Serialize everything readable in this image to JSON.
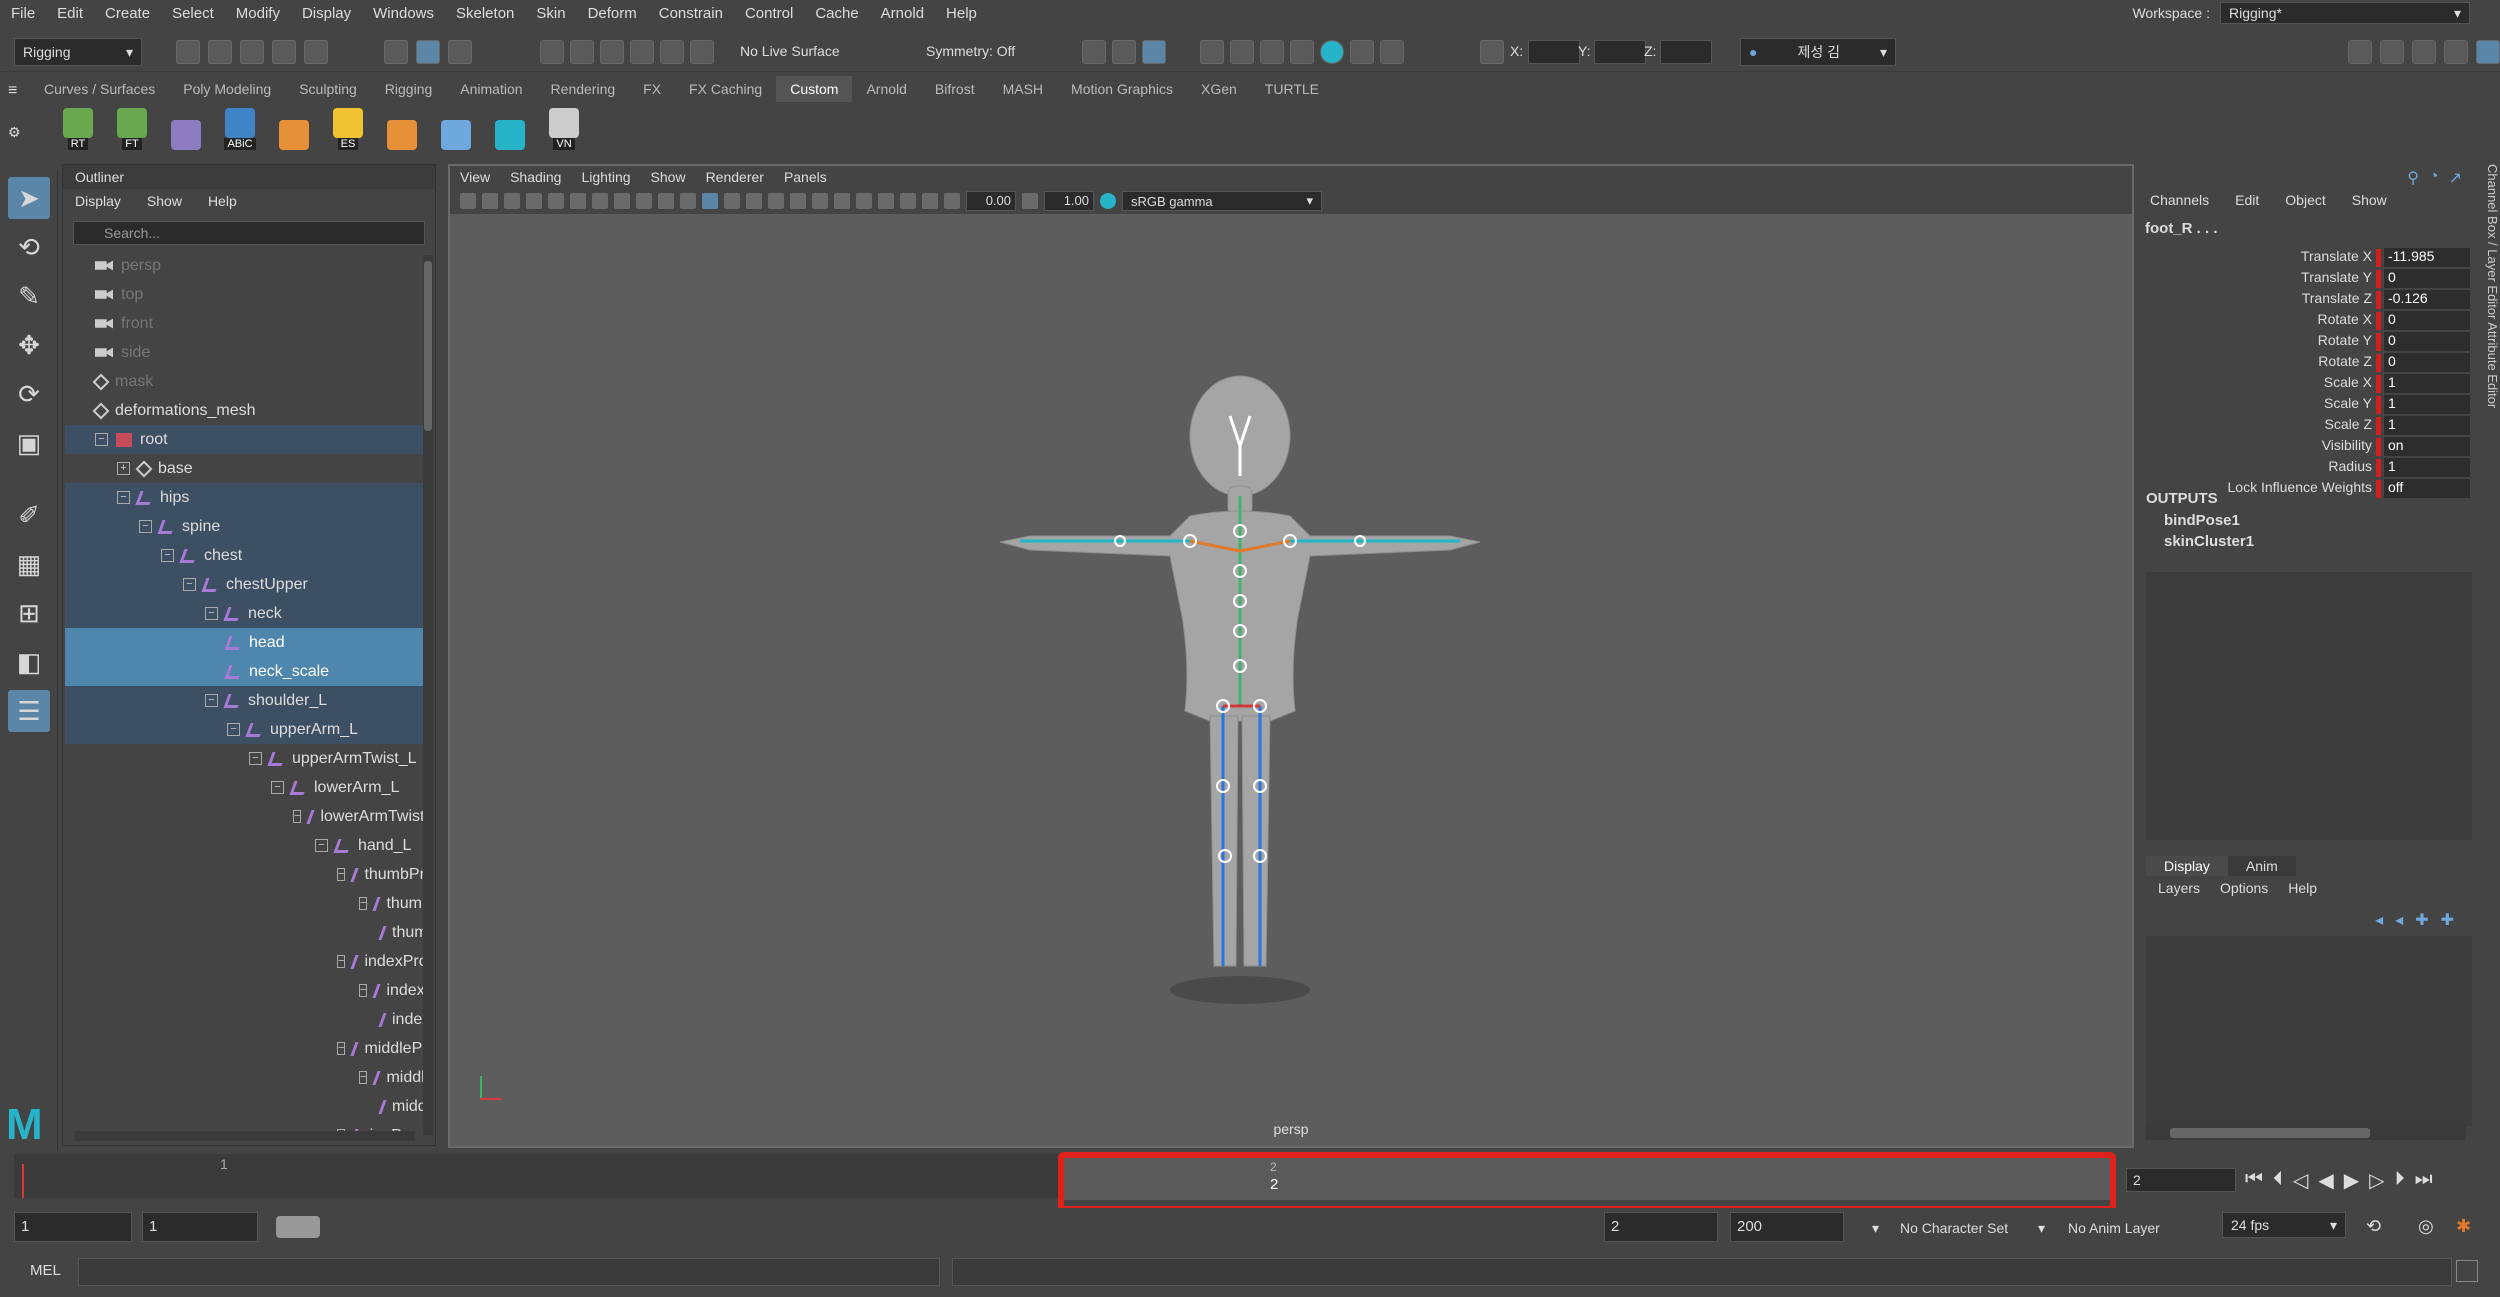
{
  "menubar": {
    "items": [
      "File",
      "Edit",
      "Create",
      "Select",
      "Modify",
      "Display",
      "Windows",
      "Skeleton",
      "Skin",
      "Deform",
      "Constrain",
      "Control",
      "Cache",
      "Arnold",
      "Help"
    ],
    "workspace_label": "Workspace :",
    "workspace_value": "Rigging*"
  },
  "statusline": {
    "mode": "Rigging",
    "live_surface": "No Live Surface",
    "symmetry": "Symmetry: Off",
    "x_label": "X:",
    "y_label": "Y:",
    "z_label": "Z:",
    "user": "제성 김"
  },
  "shelf": {
    "tabs": [
      "Curves / Surfaces",
      "Poly Modeling",
      "Sculpting",
      "Rigging",
      "Animation",
      "Rendering",
      "FX",
      "FX Caching",
      "Custom",
      "Arnold",
      "Bifrost",
      "MASH",
      "Motion Graphics",
      "XGen",
      "TURTLE"
    ],
    "active_tab": "Custom",
    "icons": [
      {
        "label": "RT",
        "icon": "joint-tool-icon"
      },
      {
        "label": "FT",
        "icon": "joint-tool-icon"
      },
      {
        "label": "",
        "icon": "cube-icon"
      },
      {
        "label": "ABiC",
        "icon": "abc-icon"
      },
      {
        "label": "",
        "icon": "paint-icon"
      },
      {
        "label": "ES",
        "icon": "folder-icon"
      },
      {
        "label": "",
        "icon": "paint-weight-icon"
      },
      {
        "label": "",
        "icon": "sphere-joint-icon"
      },
      {
        "label": "",
        "icon": "maya-icon"
      },
      {
        "label": "VN",
        "icon": "camera-icon"
      }
    ]
  },
  "outliner": {
    "title": "Outliner",
    "menu": [
      "Display",
      "Show",
      "Help"
    ],
    "search_placeholder": "Search...",
    "rows": [
      {
        "name": "persp",
        "type": "cam",
        "depth": 0,
        "state": "grey",
        "exp": ""
      },
      {
        "name": "top",
        "type": "cam",
        "depth": 0,
        "state": "grey",
        "exp": ""
      },
      {
        "name": "front",
        "type": "cam",
        "depth": 0,
        "state": "grey",
        "exp": ""
      },
      {
        "name": "side",
        "type": "cam",
        "depth": 0,
        "state": "grey",
        "exp": ""
      },
      {
        "name": "mask",
        "type": "mesh",
        "depth": 0,
        "state": "grey",
        "exp": ""
      },
      {
        "name": "deformations_mesh",
        "type": "mesh",
        "depth": 0,
        "state": "",
        "exp": ""
      },
      {
        "name": "root",
        "type": "root",
        "depth": 0,
        "state": "hl",
        "exp": "-"
      },
      {
        "name": "base",
        "type": "mesh",
        "depth": 1,
        "state": "",
        "exp": "+"
      },
      {
        "name": "hips",
        "type": "joint",
        "depth": 1,
        "state": "hl",
        "exp": "-"
      },
      {
        "name": "spine",
        "type": "joint",
        "depth": 2,
        "state": "hl",
        "exp": "-"
      },
      {
        "name": "chest",
        "type": "joint",
        "depth": 3,
        "state": "hl",
        "exp": "-"
      },
      {
        "name": "chestUpper",
        "type": "joint",
        "depth": 4,
        "state": "hl",
        "exp": "-"
      },
      {
        "name": "neck",
        "type": "joint",
        "depth": 5,
        "state": "hl",
        "exp": "-"
      },
      {
        "name": "head",
        "type": "joint",
        "depth": 6,
        "state": "sel",
        "exp": ""
      },
      {
        "name": "neck_scale",
        "type": "joint",
        "depth": 6,
        "state": "sel",
        "exp": ""
      },
      {
        "name": "shoulder_L",
        "type": "joint",
        "depth": 5,
        "state": "hl",
        "exp": "-"
      },
      {
        "name": "upperArm_L",
        "type": "joint",
        "depth": 6,
        "state": "hl",
        "exp": "-"
      },
      {
        "name": "upperArmTwist_L",
        "type": "joint",
        "depth": 7,
        "state": "",
        "exp": "-"
      },
      {
        "name": "lowerArm_L",
        "type": "joint",
        "depth": 8,
        "state": "",
        "exp": "-"
      },
      {
        "name": "lowerArmTwist_",
        "type": "joint",
        "depth": 9,
        "state": "",
        "exp": "-"
      },
      {
        "name": "hand_L",
        "type": "joint",
        "depth": 10,
        "state": "",
        "exp": "-"
      },
      {
        "name": "thumbPro_l",
        "type": "joint",
        "depth": 11,
        "state": "",
        "exp": "-"
      },
      {
        "name": "thumbInt",
        "type": "joint",
        "depth": 12,
        "state": "",
        "exp": "-"
      },
      {
        "name": "thumb",
        "type": "joint",
        "depth": 13,
        "state": "",
        "exp": ""
      },
      {
        "name": "indexPro_L",
        "type": "joint",
        "depth": 11,
        "state": "",
        "exp": "-"
      },
      {
        "name": "indexInt_",
        "type": "joint",
        "depth": 12,
        "state": "",
        "exp": "-"
      },
      {
        "name": "indexD",
        "type": "joint",
        "depth": 13,
        "state": "",
        "exp": ""
      },
      {
        "name": "middlePro_",
        "type": "joint",
        "depth": 11,
        "state": "",
        "exp": "-"
      },
      {
        "name": "middleIn",
        "type": "joint",
        "depth": 12,
        "state": "",
        "exp": "-"
      },
      {
        "name": "middle",
        "type": "joint",
        "depth": 13,
        "state": "",
        "exp": ""
      },
      {
        "name": "ringPro_L",
        "type": "joint",
        "depth": 11,
        "state": "",
        "exp": "-"
      }
    ]
  },
  "viewport": {
    "menu": [
      "View",
      "Shading",
      "Lighting",
      "Show",
      "Renderer",
      "Panels"
    ],
    "exposure": "0.00",
    "gamma": "1.00",
    "color_space": "sRGB gamma",
    "camera_label": "persp"
  },
  "channelbox": {
    "tabs": [
      "Channels",
      "Edit",
      "Object",
      "Show"
    ],
    "node": "foot_R . . .",
    "attrs": [
      {
        "name": "Translate X",
        "value": "-11.985"
      },
      {
        "name": "Translate Y",
        "value": "0"
      },
      {
        "name": "Translate Z",
        "value": "-0.126"
      },
      {
        "name": "Rotate X",
        "value": "0"
      },
      {
        "name": "Rotate Y",
        "value": "0"
      },
      {
        "name": "Rotate Z",
        "value": "0"
      },
      {
        "name": "Scale X",
        "value": "1"
      },
      {
        "name": "Scale Y",
        "value": "1"
      },
      {
        "name": "Scale Z",
        "value": "1"
      },
      {
        "name": "Visibility",
        "value": "on"
      },
      {
        "name": "Radius",
        "value": "1"
      },
      {
        "name": "Lock Influence Weights",
        "value": "off"
      }
    ],
    "outputs_label": "OUTPUTS",
    "outputs": [
      "bindPose1",
      "skinCluster1"
    ],
    "side_tabs": "Channel Box / Layer Editor    Attribute Editor"
  },
  "layereditor": {
    "tabs": [
      "Display",
      "Anim"
    ],
    "menu": [
      "Layers",
      "Options",
      "Help"
    ]
  },
  "timeslider": {
    "start_tick": "1",
    "highlight_small": "2",
    "highlight_big": "2",
    "current_frame": "2"
  },
  "rangeslider": {
    "start": "1",
    "playback_start": "1",
    "playback_end": "2",
    "end": "200",
    "character_set": "No Character Set",
    "anim_layer": "No Anim Layer",
    "fps": "24 fps"
  },
  "cmdline": {
    "label": "MEL"
  },
  "colors": {
    "highlight_box": "#e0201a",
    "selection": "#4f86ad",
    "hierarchy_hl": "#3c4f63",
    "keyed_attr": "#d31e1e"
  }
}
